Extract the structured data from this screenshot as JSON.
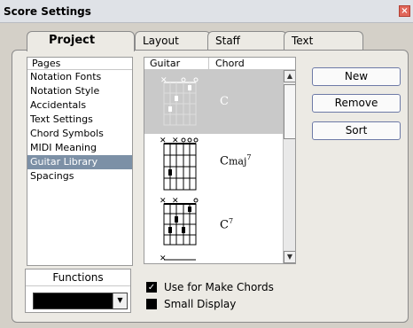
{
  "window": {
    "title": "Score Settings",
    "close_glyph": "×"
  },
  "tabs": [
    {
      "label": "Project",
      "active": true
    },
    {
      "label": "Layout",
      "active": false
    },
    {
      "label": "Staff",
      "active": false
    },
    {
      "label": "Text",
      "active": false
    }
  ],
  "pages": {
    "header": "Pages",
    "items": [
      "Notation Fonts",
      "Notation Style",
      "Accidentals",
      "Text Settings",
      "Chord Symbols",
      "MIDI Meaning",
      "Guitar Library",
      "Spacings"
    ],
    "selected": "Guitar Library"
  },
  "library": {
    "col_guitar": "Guitar",
    "col_chord": "Chord",
    "chords": [
      {
        "name": "C",
        "selected": true
      },
      {
        "name": "Cmaj7",
        "selected": false
      },
      {
        "name": "C7",
        "selected": false
      }
    ]
  },
  "buttons": {
    "new": "New",
    "remove": "Remove",
    "sort": "Sort"
  },
  "functions": {
    "label": "Functions",
    "value": ""
  },
  "options": {
    "use_for_make_chords": {
      "label": "Use for Make Chords",
      "checked": true
    },
    "small_display": {
      "label": "Small Display",
      "checked": false
    }
  },
  "colors": {
    "selection": "#7c90a6",
    "dialog_bg": "#eceae4",
    "chord_selected_bg": "#c9c9c9"
  },
  "icons": {
    "close": "close-icon",
    "scroll_up": "arrow-up-icon",
    "scroll_down": "arrow-down-icon",
    "dropdown": "chevron-down-icon"
  }
}
